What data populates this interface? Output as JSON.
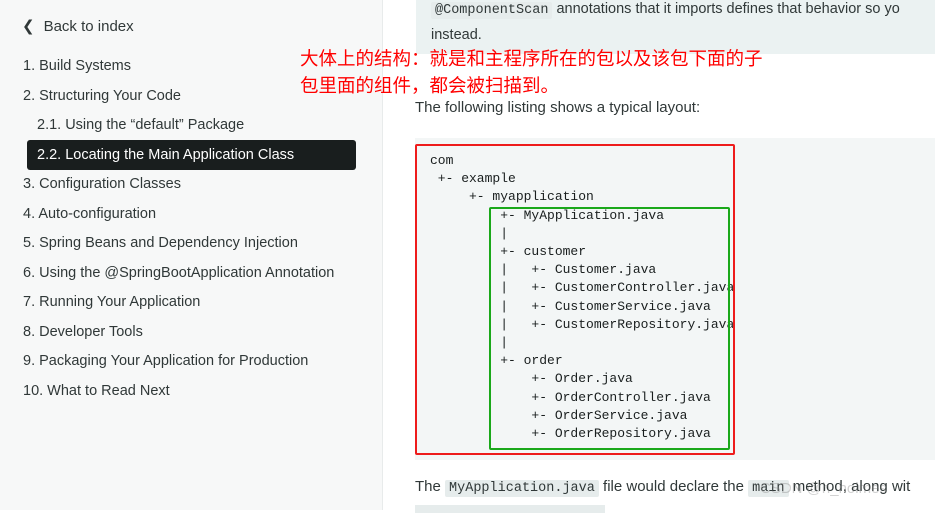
{
  "sidebar": {
    "back_label": "Back to index",
    "items": [
      {
        "label": "1. Build Systems"
      },
      {
        "label": "2. Structuring Your Code"
      },
      {
        "label": "2.1. Using the “default” Package"
      },
      {
        "label": "2.2. Locating the Main Application Class"
      },
      {
        "label": "3. Configuration Classes"
      },
      {
        "label": "4. Auto-configuration"
      },
      {
        "label": "5. Spring Beans and Dependency Injection"
      },
      {
        "label": "6. Using the @SpringBootApplication Annotation"
      },
      {
        "label": "7. Running Your Application"
      },
      {
        "label": "8. Developer Tools"
      },
      {
        "label": "9. Packaging Your Application for Production"
      },
      {
        "label": "10. What to Read Next"
      }
    ]
  },
  "main": {
    "top_code": "@ComponentScan",
    "top_text_rest": " annotations that it imports defines that behavior so yo",
    "top_text_line2": "instead.",
    "annotation_line1": "大体上的结构：就是和主程序所在的包以及该包下面的子",
    "annotation_line2": "包里面的组件，都会被扫描到。",
    "listing_intro": "The following listing shows a typical layout:",
    "code_lines": [
      "com",
      " +- example",
      "     +- myapplication",
      "         +- MyApplication.java",
      "         |",
      "         +- customer",
      "         |   +- Customer.java",
      "         |   +- CustomerController.java",
      "         |   +- CustomerService.java",
      "         |   +- CustomerRepository.java",
      "         |",
      "         +- order",
      "             +- Order.java",
      "             +- OrderController.java",
      "             +- OrderService.java",
      "             +- OrderRepository.java"
    ],
    "bottom_the": "The",
    "bottom_code": "MyApplication.java",
    "bottom_rest": "file would declare the",
    "bottom_main": "main",
    "bottom_tail": "method, along wit",
    "watermark": "CSDN @h_holmes"
  }
}
